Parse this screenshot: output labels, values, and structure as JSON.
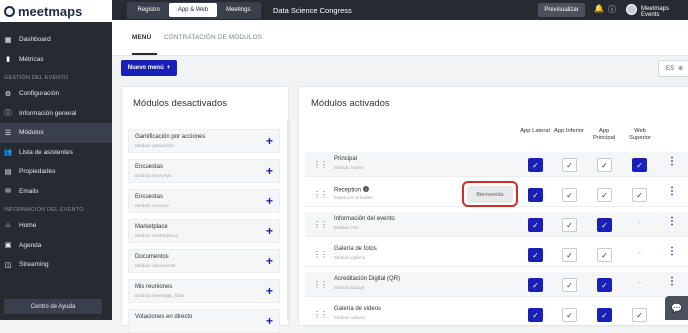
{
  "brand": {
    "name": "meetmaps"
  },
  "sidebar": {
    "items_top": [
      {
        "label": "Dashboard",
        "icon": "dashboard-icon"
      },
      {
        "label": "Métricas",
        "icon": "chart-icon"
      }
    ],
    "section_event": "GESTIÓN DEL EVENTO",
    "items_event": [
      {
        "label": "Configuración",
        "icon": "gear-icon"
      },
      {
        "label": "Información general",
        "icon": "info-icon"
      },
      {
        "label": "Módulos",
        "icon": "menu-icon"
      },
      {
        "label": "Lista de asistentes",
        "icon": "users-icon"
      },
      {
        "label": "Propiedades",
        "icon": "properties-icon"
      },
      {
        "label": "Emails",
        "icon": "mail-icon"
      }
    ],
    "section_info": "INFORMACIÓN DEL EVENTO",
    "items_info": [
      {
        "label": "Home",
        "icon": "home-icon"
      },
      {
        "label": "Agenda",
        "icon": "calendar-icon"
      },
      {
        "label": "Streaming",
        "icon": "cast-icon"
      }
    ],
    "help": "Centro de Ayuda"
  },
  "topbar": {
    "segments": [
      "Registro",
      "App & Web",
      "Meetings"
    ],
    "event_title": "Data Science Congress",
    "preview": "Previsualizar",
    "user": "Meetmaps Events"
  },
  "tabs": [
    "MENÚ",
    "CONTRATACIÓN DE MÓDULOS"
  ],
  "actions": {
    "new_menu": "Nuevo menú",
    "lang": "ES"
  },
  "inactive_panel": {
    "title": "Módulos desactivados",
    "items": [
      {
        "name": "Gamificación por acciones",
        "sub": "Módulo gamaction"
      },
      {
        "name": "Encuestas",
        "sub": "Módulo esurveys"
      },
      {
        "name": "Encuestas",
        "sub": "Módulo surveys"
      },
      {
        "name": "Marketplace",
        "sub": "Módulo marketplace"
      },
      {
        "name": "Documentos",
        "sub": "Módulo documents"
      },
      {
        "name": "Mis reuniones",
        "sub": "Módulo meetings_slots"
      },
      {
        "name": "Votaciones en directo",
        "sub": ""
      }
    ]
  },
  "active_panel": {
    "title": "Módulos activados",
    "columns": [
      "App Lateral",
      "App Inferior",
      "App Principal",
      "Web Superior"
    ],
    "rows": [
      {
        "name": "Principal",
        "sub": "Módulo home",
        "checks": [
          "on",
          "off",
          "off",
          "on"
        ]
      },
      {
        "name": "Reception",
        "sub": "Espacios virtuales",
        "checks": [
          "on",
          "off",
          "off",
          "off"
        ],
        "tag": "Bienvenida"
      },
      {
        "name": "Información del evento",
        "sub": "Módulo info",
        "checks": [
          "on",
          "off",
          "on",
          "dash"
        ]
      },
      {
        "name": "Galería de fotos",
        "sub": "Módulo gallery",
        "checks": [
          "on",
          "off",
          "off",
          "dash"
        ]
      },
      {
        "name": "Acreditación Digital (QR)",
        "sub": "Módulo badge",
        "checks": [
          "on",
          "off",
          "on",
          "dash"
        ]
      },
      {
        "name": "Galería de videos",
        "sub": "Módulo videos",
        "checks": [
          "on",
          "off",
          "on",
          "off"
        ]
      }
    ]
  },
  "colors": {
    "accent": "#1a1fb8",
    "sidebar": "#252a33",
    "highlight": "#d42a2a"
  }
}
